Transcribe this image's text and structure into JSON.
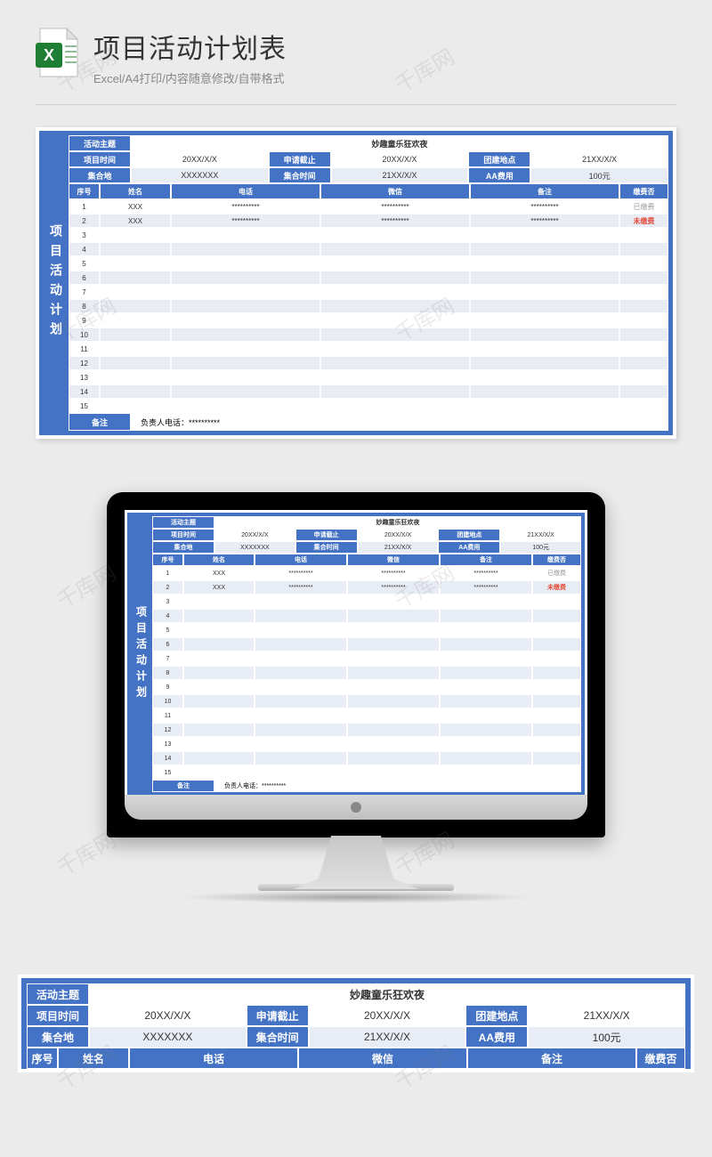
{
  "header": {
    "title": "项目活动计划表",
    "subtitle": "Excel/A4打印/内容随意修改/自带格式"
  },
  "watermark": "千库网",
  "sheet": {
    "side_title": "项目活动计划",
    "labels": {
      "theme": "活动主题",
      "project_time": "项目时间",
      "deadline": "申请截止",
      "location": "团建地点",
      "meeting_place": "集合地",
      "meeting_time": "集合时间",
      "aa_fee": "AA费用",
      "remark": "备注"
    },
    "values": {
      "theme_value": "妙趣童乐狂欢夜",
      "project_time": "20XX/X/X",
      "deadline": "20XX/X/X",
      "location": "21XX/X/X",
      "meeting_place": "XXXXXXX",
      "meeting_time": "21XX/X/X",
      "aa_fee": "100元"
    },
    "columns": {
      "seq": "序号",
      "name": "姓名",
      "phone": "电话",
      "wechat": "微信",
      "remark": "备注",
      "paid": "缴费否"
    },
    "rows": [
      {
        "seq": "1",
        "name": "XXX",
        "phone": "**********",
        "wechat": "**********",
        "remark": "**********",
        "paid": "已缴费",
        "paid_class": "paid"
      },
      {
        "seq": "2",
        "name": "XXX",
        "phone": "**********",
        "wechat": "**********",
        "remark": "**********",
        "paid": "未缴费",
        "paid_class": "unpaid"
      },
      {
        "seq": "3"
      },
      {
        "seq": "4"
      },
      {
        "seq": "5"
      },
      {
        "seq": "6"
      },
      {
        "seq": "7"
      },
      {
        "seq": "8"
      },
      {
        "seq": "9"
      },
      {
        "seq": "10"
      },
      {
        "seq": "11"
      },
      {
        "seq": "12"
      },
      {
        "seq": "13"
      },
      {
        "seq": "14"
      },
      {
        "seq": "15"
      }
    ],
    "footer": {
      "label": "备注",
      "text": "负责人电话：**********"
    }
  }
}
